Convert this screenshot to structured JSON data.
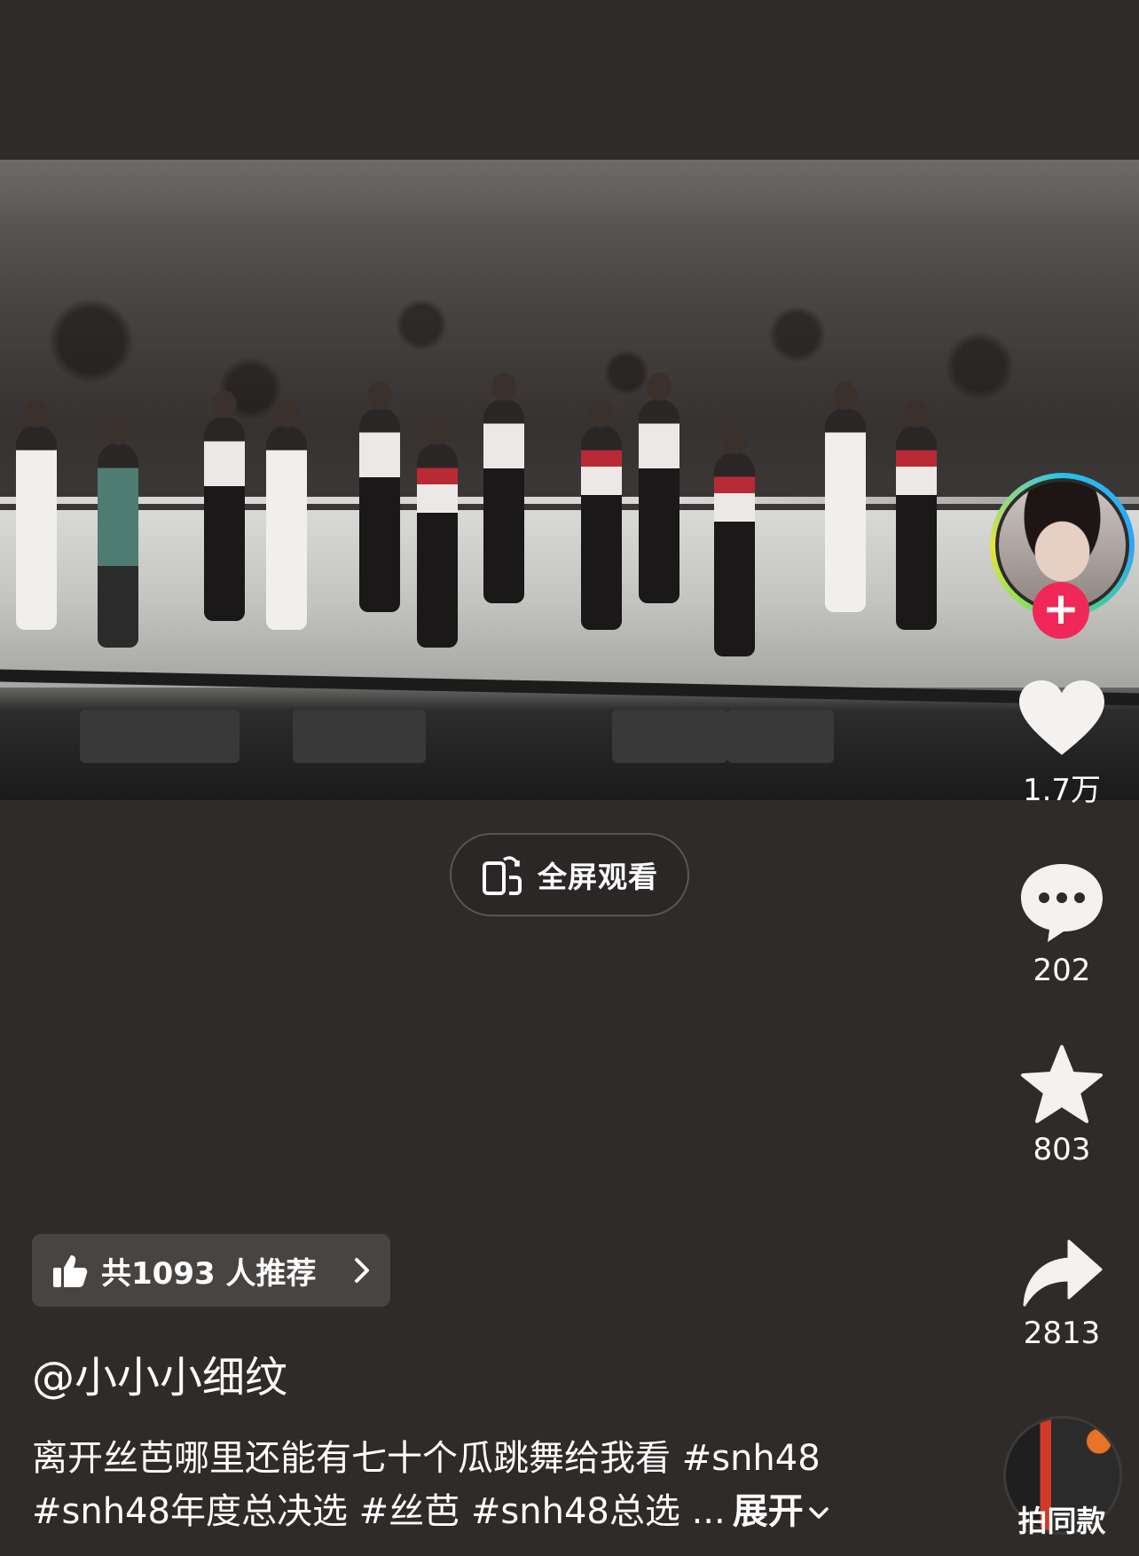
{
  "video": {
    "fullscreen_label": "全屏观看"
  },
  "actions": {
    "like_count": "1.7万",
    "comment_count": "202",
    "favorite_count": "803",
    "share_count": "2813",
    "same_style_label": "拍同款",
    "follow_symbol": "+"
  },
  "recommend": {
    "label": "共1093 人推荐"
  },
  "post": {
    "author": "@小小小细纹",
    "description_line1": "离开丝芭哪里还能有七十个瓜跳舞给我看 #snh48",
    "description_line2": "#snh48年度总决选 #丝芭 #snh48总选 ...",
    "expand_label": "展开"
  },
  "colors": {
    "background": "#2f2b29",
    "follow_red": "#f0285a",
    "chip_bg": "#484442"
  },
  "icons": [
    "fullscreen-rotate-icon",
    "heart-icon",
    "comment-dots-icon",
    "star-icon",
    "share-arrow-icon",
    "thumbs-up-icon",
    "chevron-right-icon",
    "chevron-down-icon",
    "plus-icon"
  ]
}
